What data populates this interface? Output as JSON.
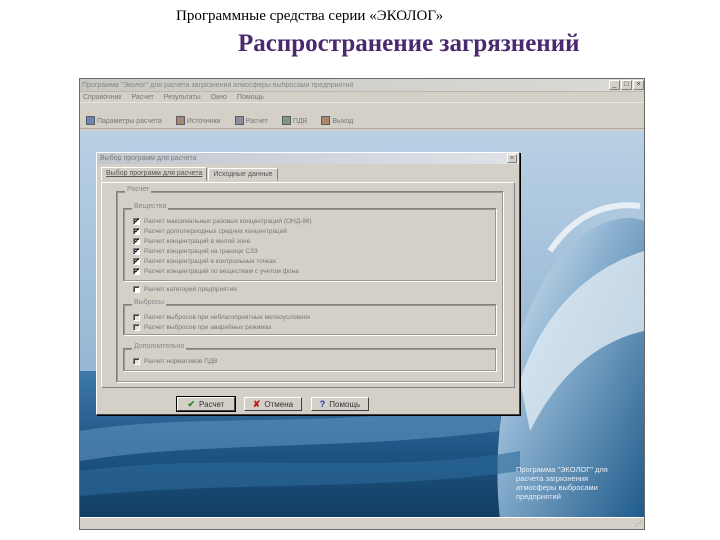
{
  "slide": {
    "header": "Программные средства серии «ЭКОЛОГ»",
    "title": "Распространение загрязнений"
  },
  "app": {
    "window_title": "Программа \"Эколог\" для расчета загрязнения атмосферы выбросами предприятий",
    "menu": [
      "Справочник",
      "Расчет",
      "Результаты",
      "Окно",
      "Помощь"
    ],
    "toolbar": [
      {
        "label": "Параметры расчета",
        "icon": "settings-icon"
      },
      {
        "label": "Источники",
        "icon": "factory-icon"
      },
      {
        "label": "Расчет",
        "icon": "calculator-icon"
      },
      {
        "label": "ПДВ",
        "icon": "chart-icon"
      },
      {
        "label": "Выход",
        "icon": "exit-icon"
      }
    ],
    "promo_text": "Программа \"ЭКОЛОГ\" для\nрасчета загрязнения\nатмосферы выбросами\nпредприятий"
  },
  "dialog": {
    "title": "Выбор программ для расчета",
    "tabs": [
      "Выбор программ для расчета",
      "Исходные данные"
    ],
    "active_tab": "Выбор программ для расчета",
    "outer_group": "Расчет",
    "groups": [
      {
        "title": "Вещества",
        "items": [
          {
            "label": "Расчет максимальных разовых концентраций (ОНД-86)",
            "checked": true,
            "enabled": true
          },
          {
            "label": "Расчет долгопериодных средних концентраций",
            "checked": true,
            "enabled": true
          },
          {
            "label": "Расчет концентраций в жилой зоне",
            "checked": true,
            "enabled": true
          },
          {
            "label": "Расчет концентраций на границе СЗЗ",
            "checked": true,
            "enabled": true
          },
          {
            "label": "Расчет концентраций в контрольных точках",
            "checked": true,
            "enabled": true
          },
          {
            "label": "Расчет концентраций по веществам с учетом фона",
            "checked": true,
            "enabled": true
          },
          {
            "label": "Расчет категорий предприятия",
            "checked": false,
            "enabled": true
          }
        ]
      },
      {
        "title": "Выбросы",
        "items": [
          {
            "label": "Расчет выбросов при неблагоприятных метеоусловиях",
            "checked": false,
            "enabled": false
          },
          {
            "label": "Расчет выбросов при аварийных режимах",
            "checked": false,
            "enabled": false
          }
        ]
      },
      {
        "title": "Дополнительно",
        "items": [
          {
            "label": "Расчет нормативов ПДВ",
            "checked": false,
            "enabled": false
          }
        ]
      }
    ],
    "buttons": [
      {
        "label": "Расчет",
        "glyph": "✔",
        "glyph_color": "#1a8a1a",
        "icon": "check-icon"
      },
      {
        "label": "Отмена",
        "glyph": "✘",
        "glyph_color": "#c01818",
        "icon": "cross-icon"
      },
      {
        "label": "Помощь",
        "glyph": "?",
        "glyph_color": "#1a3aa8",
        "icon": "help-icon"
      }
    ]
  },
  "colors": {
    "title_purple": "#4a2a6e",
    "ocean_dark": "#1c4c78",
    "ocean_light": "#8fb6d6",
    "sky": "#a8c4dc"
  }
}
